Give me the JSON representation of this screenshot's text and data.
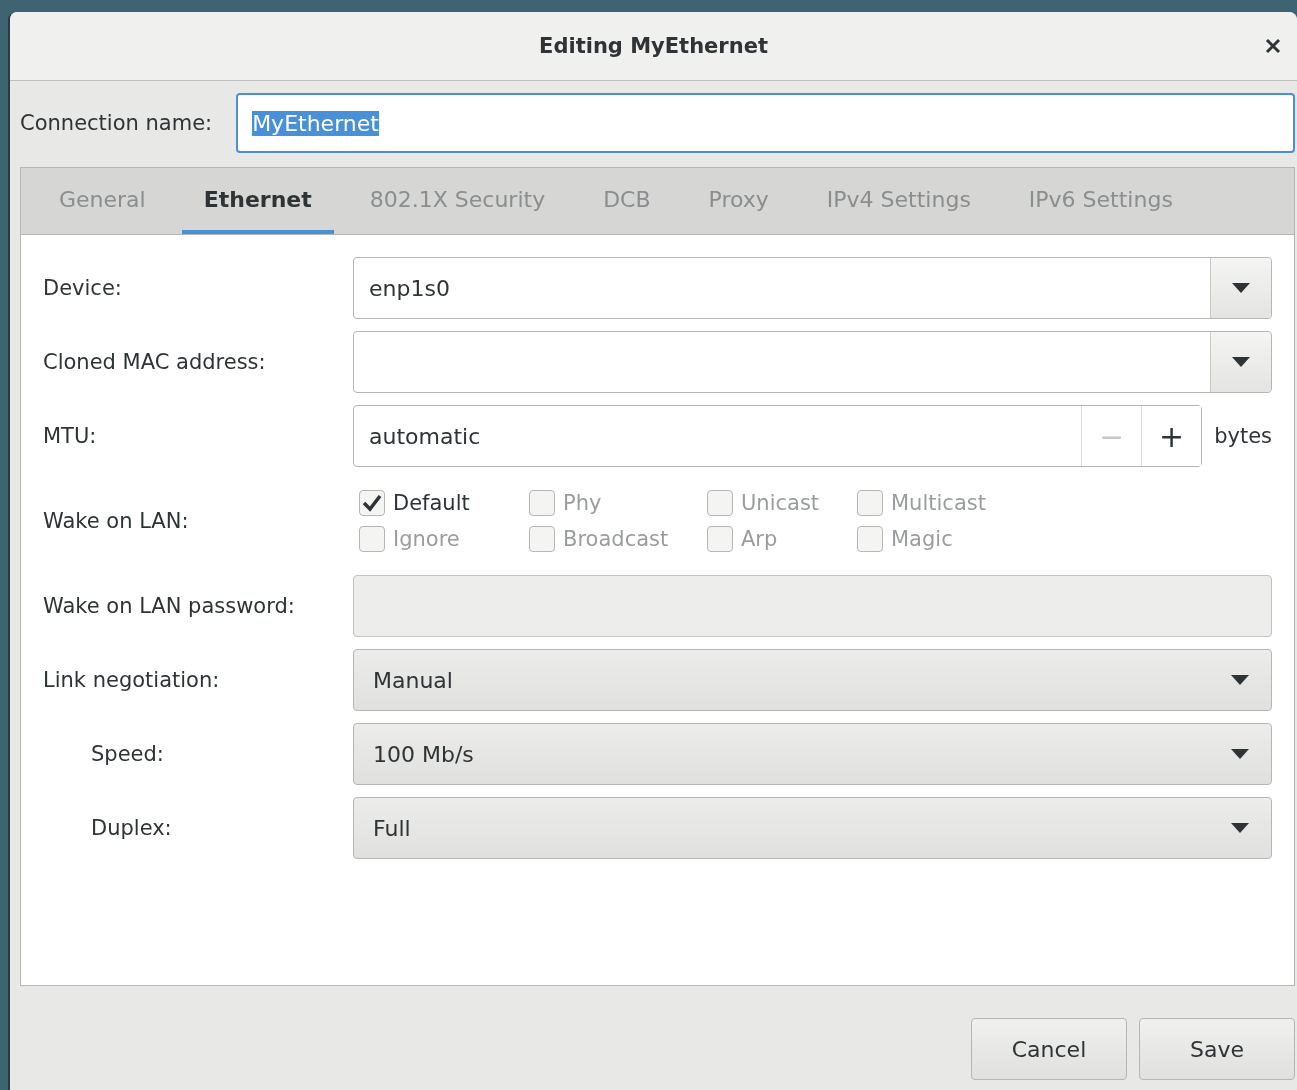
{
  "window": {
    "title": "Editing MyEthernet"
  },
  "connection_name": {
    "label": "Connection name:",
    "value": "MyEthernet",
    "text_selected": true
  },
  "tabs": [
    {
      "label": "General",
      "selected": false
    },
    {
      "label": "Ethernet",
      "selected": true
    },
    {
      "label": "802.1X Security",
      "selected": false
    },
    {
      "label": "DCB",
      "selected": false
    },
    {
      "label": "Proxy",
      "selected": false
    },
    {
      "label": "IPv4 Settings",
      "selected": false
    },
    {
      "label": "IPv6 Settings",
      "selected": false
    }
  ],
  "rows": [
    {
      "kind": "combo-entry",
      "label": "Device:",
      "value": "enp1s0"
    },
    {
      "kind": "combo-entry",
      "label": "Cloned MAC address:"
    },
    {
      "kind": "spin",
      "label": "MTU:",
      "value": "automatic",
      "minus": "−",
      "plus": "+",
      "unit": "bytes",
      "minus_disabled": true
    },
    {
      "kind": "checks",
      "label": "Wake on LAN:",
      "options": [
        {
          "label": "Default",
          "checked": true,
          "disabled": false
        },
        {
          "label": "Phy",
          "checked": false,
          "disabled": true
        },
        {
          "label": "Unicast",
          "checked": false,
          "disabled": true
        },
        {
          "label": "Multicast",
          "checked": false,
          "disabled": true
        },
        {
          "label": "Ignore",
          "checked": false,
          "disabled": true
        },
        {
          "label": "Broadcast",
          "checked": false,
          "disabled": true
        },
        {
          "label": "Arp",
          "checked": false,
          "disabled": true
        },
        {
          "label": "Magic",
          "checked": false,
          "disabled": true
        }
      ]
    },
    {
      "kind": "entry",
      "label": "Wake on LAN password:",
      "disabled": true
    },
    {
      "kind": "dropdown",
      "label": "Link negotiation:",
      "value": "Manual",
      "children": [
        {
          "kind": "dropdown",
          "label": "Speed:",
          "value": "100 Mb/s"
        },
        {
          "kind": "dropdown",
          "label": "Duplex:",
          "value": "Full"
        }
      ]
    }
  ],
  "buttons": [
    "Cancel",
    "Save"
  ]
}
